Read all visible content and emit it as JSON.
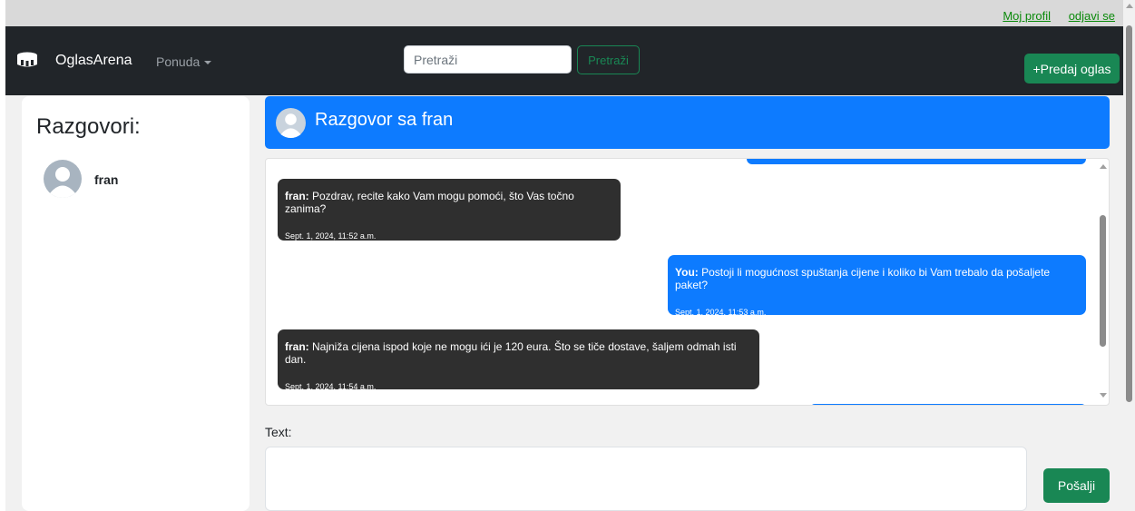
{
  "top_links": {
    "profile": "Moj profil",
    "logout": "odjavi se"
  },
  "navbar": {
    "brand": "OglasArena",
    "offer_dropdown": "Ponuda",
    "search_placeholder": "Pretraži",
    "search_button": "Pretraži",
    "sell_button": "+Predaj oglas"
  },
  "sidebar": {
    "title": "Razgovori:",
    "conversations": [
      {
        "name": "fran"
      }
    ]
  },
  "chat": {
    "header": "Razgovor sa fran",
    "messages": [
      {
        "from": "them",
        "sender": "fran:",
        "text": " Pozdrav, recite kako Vam mogu pomoći, što Vas točno zanima?",
        "time": "Sept. 1, 2024, 11:52 a.m."
      },
      {
        "from": "me",
        "sender": "You:",
        "text": " Postoji li mogućnost spuštanja cijene i koliko bi Vam trebalo da pošaljete paket?",
        "time": "Sept. 1, 2024, 11:53 a.m."
      },
      {
        "from": "them",
        "sender": "fran:",
        "text": " Najniža cijena ispod koje ne mogu ići je 120 eura. Što se tiče dostave, šaljem odmah isti dan.",
        "time": "Sept. 1, 2024, 11:54 a.m."
      }
    ]
  },
  "composer": {
    "label": "Text:",
    "send_button": "Pošalji"
  },
  "colors": {
    "primary_blue": "#0d7bff",
    "success_green": "#198754",
    "navbar_dark": "#212529",
    "bubble_dark": "#2f2f2f"
  }
}
